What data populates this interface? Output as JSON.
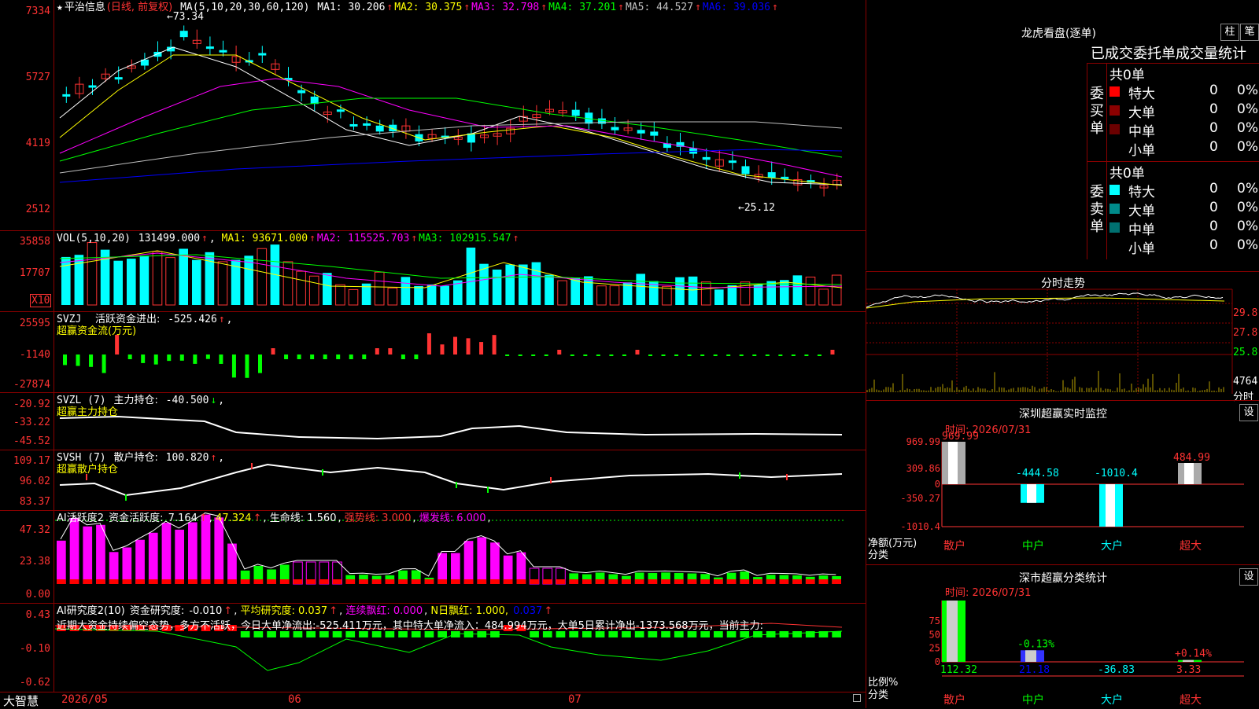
{
  "colors": {
    "up": "#ff3333",
    "down": "#00ffff",
    "bg": "#000000",
    "grid": "#8b0000",
    "ma1": "#ffffff",
    "ma2": "#ffff00",
    "ma3": "#ff00ff",
    "ma4": "#00ff00",
    "ma5": "#c0c0c0",
    "ma6": "#0000ff"
  },
  "main": {
    "stock_name": "平治信息",
    "period": "(日线, 前复权)",
    "ma_label": "MA(5,10,20,30,60,120)",
    "ma": [
      {
        "k": "MA1:",
        "v": "30.206",
        "c": "#ffffff"
      },
      {
        "k": "MA2:",
        "v": "30.375",
        "c": "#ffff00"
      },
      {
        "k": "MA3:",
        "v": "32.798",
        "c": "#ff00ff"
      },
      {
        "k": "MA4:",
        "v": "37.201",
        "c": "#00ff00"
      },
      {
        "k": "MA5:",
        "v": "44.527",
        "c": "#c0c0c0"
      },
      {
        "k": "MA6:",
        "v": "39.036",
        "c": "#0000ff"
      }
    ],
    "ticks": [
      "7334",
      "5727",
      "4119",
      "2512"
    ],
    "high_label": "73.34",
    "low_label": "25.12"
  },
  "vol": {
    "label": "VOL(5,10,20)",
    "value": "131499.000",
    "ma": [
      {
        "k": "MA1:",
        "v": "93671.000",
        "c": "#ffff00"
      },
      {
        "k": "MA2:",
        "v": "115525.703",
        "c": "#ff00ff"
      },
      {
        "k": "MA3:",
        "v": "102915.547",
        "c": "#00ff00"
      }
    ],
    "ticks": [
      "35858",
      "17707"
    ],
    "unit": "X10"
  },
  "svzj": {
    "label": "SVZJ",
    "name": "活跃资金进出:",
    "value": "-525.426",
    "sub": "超赢资金流(万元)",
    "ticks": [
      "25595",
      "-1140",
      "-27874"
    ]
  },
  "svzl": {
    "label": "SVZL (7)",
    "name": "主力持仓:",
    "value": "-40.500",
    "sub": "超赢主力持仓",
    "ticks": [
      "-20.92",
      "-33.22",
      "-45.52"
    ]
  },
  "svsh": {
    "label": "SVSH (7)",
    "name": "散户持仓:",
    "value": "100.820",
    "sub": "超赢散户持仓",
    "ticks": [
      "109.17",
      "96.02",
      "83.37"
    ]
  },
  "ai1": {
    "label": "AI活跃度2",
    "name": "资金活跃度:",
    "value": "7.164",
    "v2": "47.324",
    "life": "生命线: 1.560",
    "strong": "强势线: 3.000",
    "burst": "爆发线: 6.000",
    "ticks": [
      "47.32",
      "23.38",
      "0.00"
    ]
  },
  "ai2": {
    "label": "AI研究度2(10)",
    "name": "资金研究度:",
    "value": "-0.010",
    "avg": "平均研究度: 0.037",
    "cont": "连续飘红: 0.000",
    "nday": "N日飘红: 1.000,",
    "extra": "0.037",
    "text": "近期大资金持续偏空态势，多方不活跃，今日大单净流出:-525.411万元，其中特大单净流入：484.994万元，大单5日累计净出-1373.568万元，当前主力:",
    "ticks": [
      "0.43",
      "-0.10",
      "-0.62"
    ]
  },
  "bottom": {
    "brand": "大智慧",
    "d1": "2026/05",
    "d2": "06",
    "d3": "07"
  },
  "lh": {
    "title": "龙虎看盘(逐单)",
    "btn1": "柱",
    "btn2": "笔",
    "header": "已成交委托单成交量统计",
    "buy_side": "委买单",
    "sell_side": "委卖单",
    "buy_total": "共0单",
    "sell_total": "共0单",
    "buy": [
      {
        "n": "特大",
        "v": "0",
        "p": "0%",
        "c": "#ff0000"
      },
      {
        "n": "大单",
        "v": "0",
        "p": "0%",
        "c": "#8b0000"
      },
      {
        "n": "中单",
        "v": "0",
        "p": "0%",
        "c": "#6b0000"
      },
      {
        "n": "小单",
        "v": "0",
        "p": "0%",
        "c": ""
      }
    ],
    "sell": [
      {
        "n": "特大",
        "v": "0",
        "p": "0%",
        "c": "#00ffff"
      },
      {
        "n": "大单",
        "v": "0",
        "p": "0%",
        "c": "#008b8b"
      },
      {
        "n": "中单",
        "v": "0",
        "p": "0%",
        "c": "#007070"
      },
      {
        "n": "小单",
        "v": "0",
        "p": "0%",
        "c": ""
      }
    ]
  },
  "fs": {
    "title": "分时走势",
    "ticks": [
      "29.8",
      "27.8",
      "25.8"
    ],
    "vol_tick": "4764",
    "vol_unit": "分时"
  },
  "sz1": {
    "title": "深圳超赢实时监控",
    "btn": "设",
    "time": "时间: 2026/07/31",
    "ticks": [
      "969.99",
      "309.86",
      "0",
      "-350.27",
      "-1010.4"
    ],
    "ylab": "净额(万元)",
    "xlab": "分类",
    "cats": [
      {
        "n": "散户",
        "v": 969.99,
        "t": "969.99"
      },
      {
        "n": "中户",
        "v": -444.58,
        "t": "-444.58"
      },
      {
        "n": "大户",
        "v": -1010.4,
        "t": "-1010.4"
      },
      {
        "n": "超大",
        "v": 484.99,
        "t": "484.99"
      }
    ]
  },
  "sz2": {
    "title": "深市超赢分类统计",
    "btn": "设",
    "time": "时间: 2026/07/31",
    "ticks": [
      "75",
      "50",
      "25",
      "0"
    ],
    "ylab": "比例%",
    "xlab": "分类",
    "cats": [
      {
        "n": "散户",
        "v": 112.32,
        "t": "112.32",
        "pct": ""
      },
      {
        "n": "中户",
        "v": 21.18,
        "t": "21.18",
        "pct": "-0.13%"
      },
      {
        "n": "大户",
        "v": -36.83,
        "t": "-36.83",
        "pct": ""
      },
      {
        "n": "超大",
        "v": 3.33,
        "t": "3.33",
        "pct": "+0.14%"
      }
    ]
  }
}
